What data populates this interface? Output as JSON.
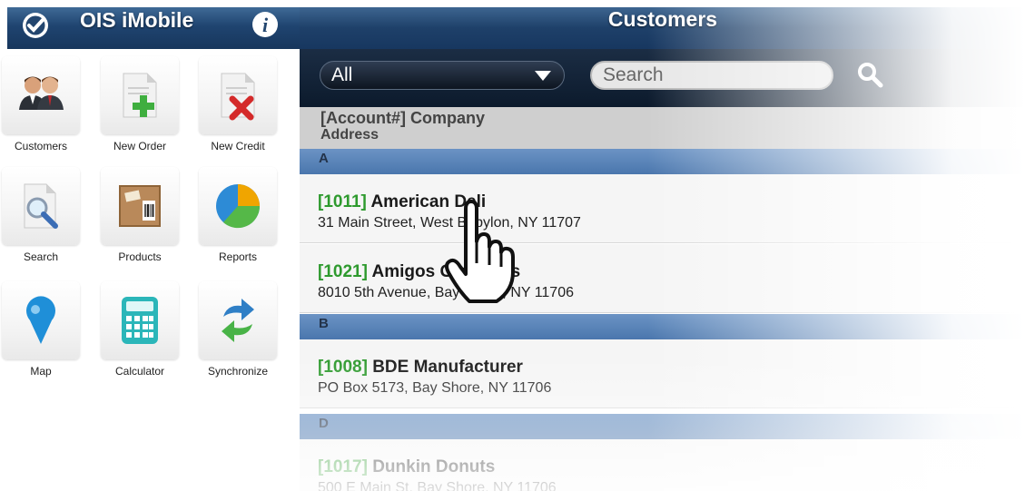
{
  "app": {
    "title": "OIS iMobile"
  },
  "menu": {
    "tiles": [
      {
        "label": "Customers",
        "icon": "customers-icon"
      },
      {
        "label": "New Order",
        "icon": "new-order-icon"
      },
      {
        "label": "New Credit",
        "icon": "new-credit-icon"
      },
      {
        "label": "Search",
        "icon": "search-document-icon"
      },
      {
        "label": "Products",
        "icon": "products-box-icon"
      },
      {
        "label": "Reports",
        "icon": "pie-chart-icon"
      },
      {
        "label": "Map",
        "icon": "map-pin-icon"
      },
      {
        "label": "Calculator",
        "icon": "calculator-icon"
      },
      {
        "label": "Synchronize",
        "icon": "sync-arrows-icon"
      }
    ]
  },
  "customers": {
    "title": "Customers",
    "filter_value": "All",
    "search_placeholder": "Search",
    "column_header": {
      "line1": "[Account#] Company",
      "line2": "Address"
    },
    "sections": [
      {
        "letter": "A",
        "rows": [
          {
            "account": "[1011]",
            "company": "American Deli",
            "address": "31 Main Street, West Babylon, NY 11707"
          },
          {
            "account": "[1021]",
            "company": "Amigos Groceries",
            "address": "8010 5th Avenue, Bay Shore, NY 11706"
          }
        ]
      },
      {
        "letter": "B",
        "rows": [
          {
            "account": "[1008]",
            "company": "BDE Manufacturer",
            "address": "PO Box 5173, Bay Shore, NY 11706"
          }
        ]
      },
      {
        "letter": "D",
        "rows": [
          {
            "account": "[1017]",
            "company": "Dunkin Donuts",
            "address": "500 E Main St, Bay Shore, NY 11706"
          }
        ]
      }
    ]
  },
  "colors": {
    "header_navy": "#1f4470",
    "filter_bar": "#0c1a2c",
    "section_blue": "#4a76ad",
    "account_green": "#2e9a2e"
  }
}
